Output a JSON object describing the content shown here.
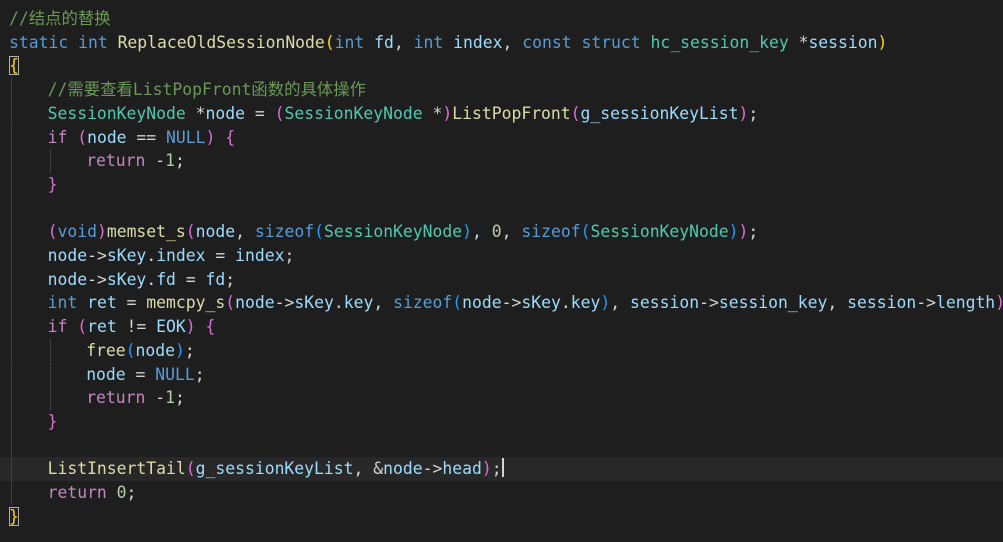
{
  "editor": {
    "theme_colors": {
      "background": "#1e1e1e",
      "comment": "#6a9955",
      "keyword": "#569cd6",
      "control": "#c586c0",
      "type": "#4ec9b0",
      "function": "#dcdcaa",
      "variable": "#9cdcfe",
      "number": "#b5cea8",
      "plain": "#d4d4d4",
      "bracket_level_1": "#ffd700",
      "bracket_level_2": "#da70d6",
      "bracket_level_3": "#179fff"
    },
    "cursor": {
      "line": 20,
      "after_text": "ListInsertTail(g_sessionKeyList, &node->head);"
    },
    "lines": [
      {
        "indent": 0,
        "tokens": [
          {
            "t": "//结点的替换",
            "c": "comment"
          }
        ]
      },
      {
        "indent": 0,
        "tokens": [
          {
            "t": "static ",
            "c": "keyword"
          },
          {
            "t": "int ",
            "c": "keyword"
          },
          {
            "t": "ReplaceOldSessionNode",
            "c": "func"
          },
          {
            "t": "(",
            "c": "bracket1"
          },
          {
            "t": "int ",
            "c": "keyword"
          },
          {
            "t": "fd",
            "c": "var"
          },
          {
            "t": ", ",
            "c": "plain"
          },
          {
            "t": "int ",
            "c": "keyword"
          },
          {
            "t": "index",
            "c": "var"
          },
          {
            "t": ", ",
            "c": "plain"
          },
          {
            "t": "const ",
            "c": "keyword"
          },
          {
            "t": "struct ",
            "c": "keyword"
          },
          {
            "t": "hc_session_key ",
            "c": "type"
          },
          {
            "t": "*",
            "c": "plain"
          },
          {
            "t": "session",
            "c": "var"
          },
          {
            "t": ")",
            "c": "bracket1"
          }
        ]
      },
      {
        "indent": 0,
        "tokens": [
          {
            "t": "{",
            "c": "bracket1",
            "box": true
          }
        ]
      },
      {
        "indent": 1,
        "tokens": [
          {
            "t": "//需要查看ListPopFront函数的具体操作",
            "c": "comment"
          }
        ]
      },
      {
        "indent": 1,
        "tokens": [
          {
            "t": "SessionKeyNode ",
            "c": "type"
          },
          {
            "t": "*",
            "c": "plain"
          },
          {
            "t": "node",
            "c": "var"
          },
          {
            "t": " = ",
            "c": "plain"
          },
          {
            "t": "(",
            "c": "bracket2"
          },
          {
            "t": "SessionKeyNode ",
            "c": "type"
          },
          {
            "t": "*",
            "c": "plain"
          },
          {
            "t": ")",
            "c": "bracket2"
          },
          {
            "t": "ListPopFront",
            "c": "func"
          },
          {
            "t": "(",
            "c": "bracket2"
          },
          {
            "t": "g_sessionKeyList",
            "c": "var"
          },
          {
            "t": ")",
            "c": "bracket2"
          },
          {
            "t": ";",
            "c": "plain"
          }
        ]
      },
      {
        "indent": 1,
        "tokens": [
          {
            "t": "if ",
            "c": "control"
          },
          {
            "t": "(",
            "c": "bracket2"
          },
          {
            "t": "node",
            "c": "var"
          },
          {
            "t": " == ",
            "c": "plain"
          },
          {
            "t": "NULL",
            "c": "const"
          },
          {
            "t": ")",
            "c": "bracket2"
          },
          {
            "t": " ",
            "c": "plain"
          },
          {
            "t": "{",
            "c": "bracket2"
          }
        ]
      },
      {
        "indent": 2,
        "tokens": [
          {
            "t": "return ",
            "c": "control"
          },
          {
            "t": "-",
            "c": "plain"
          },
          {
            "t": "1",
            "c": "num"
          },
          {
            "t": ";",
            "c": "plain"
          }
        ]
      },
      {
        "indent": 1,
        "tokens": [
          {
            "t": "}",
            "c": "bracket2"
          }
        ]
      },
      {
        "indent": 1,
        "tokens": []
      },
      {
        "indent": 1,
        "tokens": [
          {
            "t": "(",
            "c": "bracket2"
          },
          {
            "t": "void",
            "c": "keyword"
          },
          {
            "t": ")",
            "c": "bracket2"
          },
          {
            "t": "memset_s",
            "c": "func"
          },
          {
            "t": "(",
            "c": "bracket2"
          },
          {
            "t": "node",
            "c": "var"
          },
          {
            "t": ", ",
            "c": "plain"
          },
          {
            "t": "sizeof",
            "c": "keyword"
          },
          {
            "t": "(",
            "c": "bracket3"
          },
          {
            "t": "SessionKeyNode",
            "c": "type"
          },
          {
            "t": ")",
            "c": "bracket3"
          },
          {
            "t": ", ",
            "c": "plain"
          },
          {
            "t": "0",
            "c": "num"
          },
          {
            "t": ", ",
            "c": "plain"
          },
          {
            "t": "sizeof",
            "c": "keyword"
          },
          {
            "t": "(",
            "c": "bracket3"
          },
          {
            "t": "SessionKeyNode",
            "c": "type"
          },
          {
            "t": ")",
            "c": "bracket3"
          },
          {
            "t": ")",
            "c": "bracket2"
          },
          {
            "t": ";",
            "c": "plain"
          }
        ]
      },
      {
        "indent": 1,
        "tokens": [
          {
            "t": "node",
            "c": "var"
          },
          {
            "t": "->",
            "c": "plain"
          },
          {
            "t": "sKey",
            "c": "var"
          },
          {
            "t": ".",
            "c": "plain"
          },
          {
            "t": "index",
            "c": "var"
          },
          {
            "t": " = ",
            "c": "plain"
          },
          {
            "t": "index",
            "c": "var"
          },
          {
            "t": ";",
            "c": "plain"
          }
        ]
      },
      {
        "indent": 1,
        "tokens": [
          {
            "t": "node",
            "c": "var"
          },
          {
            "t": "->",
            "c": "plain"
          },
          {
            "t": "sKey",
            "c": "var"
          },
          {
            "t": ".",
            "c": "plain"
          },
          {
            "t": "fd",
            "c": "var"
          },
          {
            "t": " = ",
            "c": "plain"
          },
          {
            "t": "fd",
            "c": "var"
          },
          {
            "t": ";",
            "c": "plain"
          }
        ]
      },
      {
        "indent": 1,
        "tokens": [
          {
            "t": "int ",
            "c": "keyword"
          },
          {
            "t": "ret",
            "c": "var"
          },
          {
            "t": " = ",
            "c": "plain"
          },
          {
            "t": "memcpy_s",
            "c": "func"
          },
          {
            "t": "(",
            "c": "bracket2"
          },
          {
            "t": "node",
            "c": "var"
          },
          {
            "t": "->",
            "c": "plain"
          },
          {
            "t": "sKey",
            "c": "var"
          },
          {
            "t": ".",
            "c": "plain"
          },
          {
            "t": "key",
            "c": "var"
          },
          {
            "t": ", ",
            "c": "plain"
          },
          {
            "t": "sizeof",
            "c": "keyword"
          },
          {
            "t": "(",
            "c": "bracket3"
          },
          {
            "t": "node",
            "c": "var"
          },
          {
            "t": "->",
            "c": "plain"
          },
          {
            "t": "sKey",
            "c": "var"
          },
          {
            "t": ".",
            "c": "plain"
          },
          {
            "t": "key",
            "c": "var"
          },
          {
            "t": ")",
            "c": "bracket3"
          },
          {
            "t": ", ",
            "c": "plain"
          },
          {
            "t": "session",
            "c": "var"
          },
          {
            "t": "->",
            "c": "plain"
          },
          {
            "t": "session_key",
            "c": "var"
          },
          {
            "t": ", ",
            "c": "plain"
          },
          {
            "t": "session",
            "c": "var"
          },
          {
            "t": "->",
            "c": "plain"
          },
          {
            "t": "length",
            "c": "var"
          },
          {
            "t": ")",
            "c": "bracket2"
          },
          {
            "t": ";",
            "c": "plain"
          }
        ]
      },
      {
        "indent": 1,
        "tokens": [
          {
            "t": "if ",
            "c": "control"
          },
          {
            "t": "(",
            "c": "bracket2"
          },
          {
            "t": "ret",
            "c": "var"
          },
          {
            "t": " != ",
            "c": "plain"
          },
          {
            "t": "EOK",
            "c": "var"
          },
          {
            "t": ")",
            "c": "bracket2"
          },
          {
            "t": " ",
            "c": "plain"
          },
          {
            "t": "{",
            "c": "bracket2"
          }
        ]
      },
      {
        "indent": 2,
        "tokens": [
          {
            "t": "free",
            "c": "func"
          },
          {
            "t": "(",
            "c": "bracket3"
          },
          {
            "t": "node",
            "c": "var"
          },
          {
            "t": ")",
            "c": "bracket3"
          },
          {
            "t": ";",
            "c": "plain"
          }
        ]
      },
      {
        "indent": 2,
        "tokens": [
          {
            "t": "node",
            "c": "var"
          },
          {
            "t": " = ",
            "c": "plain"
          },
          {
            "t": "NULL",
            "c": "const"
          },
          {
            "t": ";",
            "c": "plain"
          }
        ]
      },
      {
        "indent": 2,
        "tokens": [
          {
            "t": "return ",
            "c": "control"
          },
          {
            "t": "-",
            "c": "plain"
          },
          {
            "t": "1",
            "c": "num"
          },
          {
            "t": ";",
            "c": "plain"
          }
        ]
      },
      {
        "indent": 1,
        "tokens": [
          {
            "t": "}",
            "c": "bracket2"
          }
        ]
      },
      {
        "indent": 1,
        "tokens": []
      },
      {
        "indent": 1,
        "current": true,
        "tokens": [
          {
            "t": "ListInsertTail",
            "c": "func"
          },
          {
            "t": "(",
            "c": "bracket2"
          },
          {
            "t": "g_sessionKeyList",
            "c": "var"
          },
          {
            "t": ", ",
            "c": "plain"
          },
          {
            "t": "&",
            "c": "plain"
          },
          {
            "t": "node",
            "c": "var"
          },
          {
            "t": "->",
            "c": "plain"
          },
          {
            "t": "head",
            "c": "var"
          },
          {
            "t": ")",
            "c": "bracket2"
          },
          {
            "t": ";",
            "c": "plain"
          }
        ]
      },
      {
        "indent": 1,
        "tokens": [
          {
            "t": "return ",
            "c": "control"
          },
          {
            "t": "0",
            "c": "num"
          },
          {
            "t": ";",
            "c": "plain"
          }
        ]
      },
      {
        "indent": 0,
        "tokens": [
          {
            "t": "}",
            "c": "bracket1",
            "box": true
          }
        ]
      }
    ]
  }
}
